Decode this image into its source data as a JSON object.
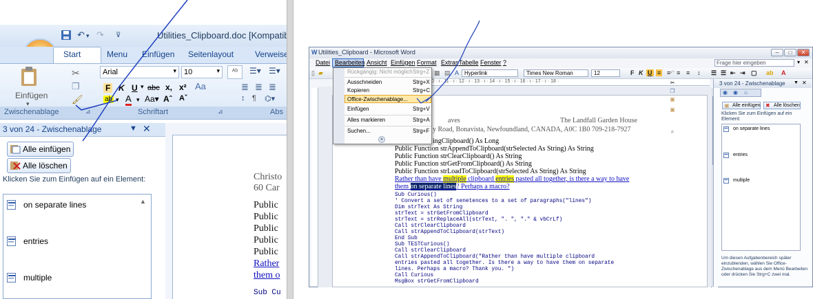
{
  "left": {
    "doc_title": "Utilities_Clipboard.doc [Kompatibilit",
    "tabs": [
      "Start",
      "Menu",
      "Einfügen",
      "Seitenlayout",
      "Verweise"
    ],
    "paste_label": "Einfügen",
    "font_name": "Arial",
    "font_size": "10",
    "group_clipboard": "Zwischenablage",
    "group_font": "Schriftart",
    "group_para": "Abs",
    "taskpane": {
      "title": "3 von 24 - Zwischenablage",
      "paste_all": "Alle einfügen",
      "clear_all": "Alle löschen",
      "hint": "Klicken Sie zum Einfügen auf ein Element:",
      "items": [
        "on separate lines",
        "entries",
        "multiple"
      ]
    },
    "doc_lines": [
      "Christo",
      "60 Car",
      "Public",
      "Public",
      "Public",
      "Public",
      "Public",
      "Rather",
      "them o",
      "Sub Cu"
    ]
  },
  "right": {
    "title": "Utilities_Clipboard - Microsoft Word",
    "menus": [
      "Datei",
      "Bearbeiten",
      "Ansicht",
      "Einfügen",
      "Format",
      "Extras",
      "Tabelle",
      "Fenster",
      "?"
    ],
    "help_placeholder": "Frage hier eingeben",
    "style_box": "Hyperlink",
    "font_box": "Times New Roman",
    "size_box": "12",
    "edit_menu": [
      {
        "label": "Rückgängig: Nicht möglich",
        "shortcut": "Strg+Z",
        "disabled": true
      },
      {
        "label": "Ausschneiden",
        "shortcut": "Strg+X"
      },
      {
        "label": "Kopieren",
        "shortcut": "Strg+C"
      },
      {
        "label": "Office-Zwischenablage...",
        "shortcut": ""
      },
      {
        "label": "Einfügen",
        "shortcut": "Strg+V"
      },
      {
        "label": "Alles markieren",
        "shortcut": "Strg+A"
      },
      {
        "label": "Suchen...",
        "shortcut": "Strg+F"
      }
    ],
    "doc": {
      "addr_right": "The Landfall Garden House",
      "addr_line": "y Road, Bonavista, Newfoundland, CANADA, A0C 1B0   709-218-7927",
      "l1": "ingClipboard() As Long",
      "l2": "Public Function strAppendToClipboard(strSelected As String) As String",
      "l3": "Public Function strClearClipboard() As String",
      "l4": "Public Function strGetFromClipboard() As String",
      "l5": "Public Function strLoadToClipboard(strSelected As String) As String",
      "l6a": "Rather than have ",
      "l6b": "multiple",
      "l6c": " clipboard ",
      "l6d": "entries",
      "l6e": " pasted all together, is there a way to have",
      "l7a": "them ",
      "l7b": "on separate lines",
      "l7c": "? Perhaps a macro?",
      "code": [
        "Sub Curious()",
        "'    Convert a set of senetences to a set of paragraphs(\"lines\")",
        "    Dim strText As String",
        "    strText = strGetFromClipboard",
        "    strText = strReplaceAll(strText, \". \", \".\" & vbCrLf)",
        "    Call strClearClipboard",
        "    Call strAppendToClipboard(strText)",
        "End Sub",
        "Sub TESTCurious()",
        "    Call strClearClipboard",
        "    Call strAppendToClipboard(\"Rather than have multiple clipboard",
        "entries pasted all together.  Is there a way to have them on separate",
        "lines. Perhaps a macro? Thank you. \")",
        "    Call Curious",
        "    MsgBox strGetFromClipboard"
      ],
      "addr_left": "aves"
    },
    "taskpane": {
      "title": "3 von 24 - Zwischenablage",
      "paste_all": "Alle einfügen",
      "clear_all": "Alle löschen",
      "hint": "Klicken Sie zum Einfügen auf ein Element:",
      "items": [
        "on separate lines",
        "entries",
        "multiple"
      ],
      "footer": "Um diesen Aufgabenbereich später einzublenden, wählen Sie Office-Zwischenablage aus dem Menü Bearbeiten oder drücken Sie Strg+C zwei mal."
    }
  },
  "colors": {
    "ribbon": "#dbe8f8",
    "highlight_yellow": "#ffff00",
    "selection": "#0a246a",
    "pen": "#1f3fbf"
  }
}
